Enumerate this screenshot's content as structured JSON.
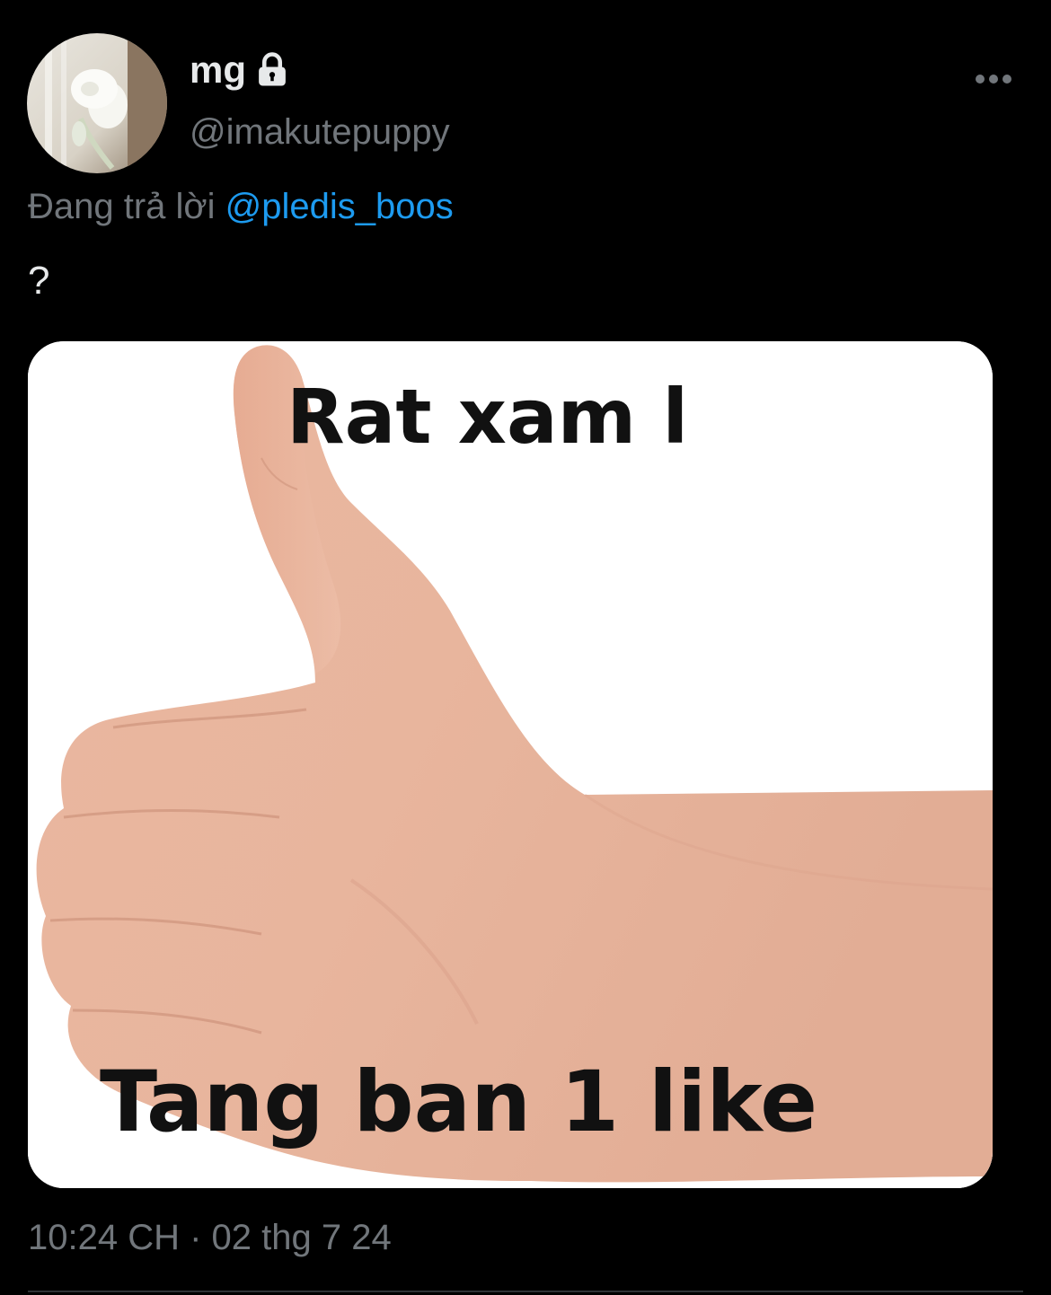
{
  "tweet": {
    "display_name": "mg",
    "handle": "@imakutepuppy",
    "reply_prefix": "Đang trả lời",
    "reply_to": "@pledis_boos",
    "text": "?",
    "timestamp": "10:24 CH · 02 thg 7 24"
  },
  "media": {
    "caption_top": "Rat xam l",
    "caption_bottom": "Tang ban 1 like"
  },
  "icons": {
    "protected": "lock-icon",
    "more": "more-options-icon"
  },
  "colors": {
    "background": "#000000",
    "primary_text": "#e7e9ea",
    "secondary_text": "#71767b",
    "link": "#1d9bf0"
  }
}
